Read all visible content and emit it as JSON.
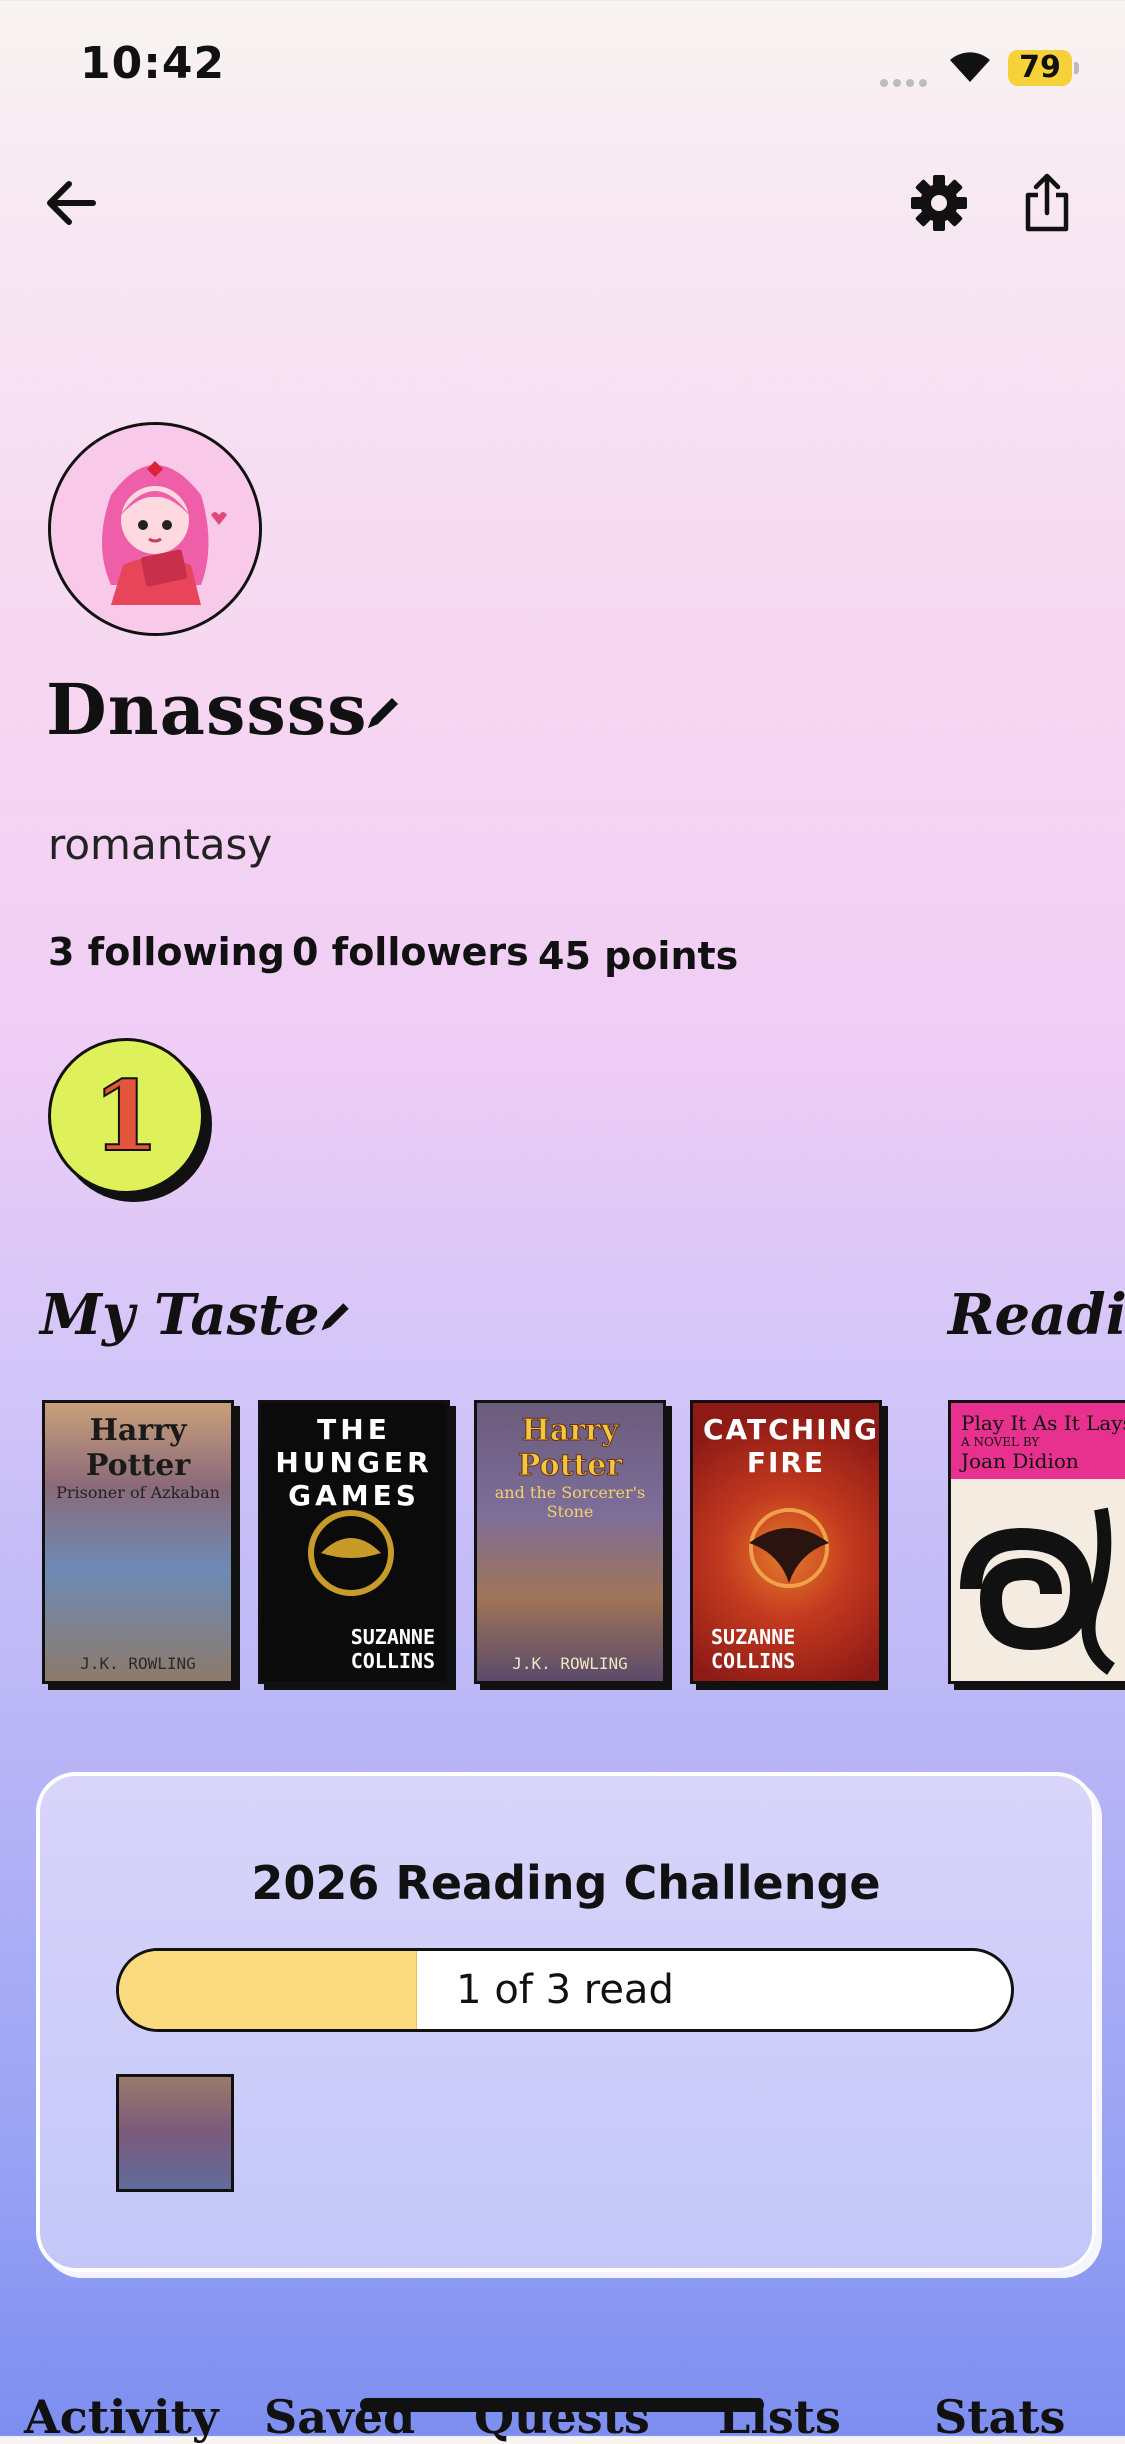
{
  "status_bar": {
    "time": "10:42",
    "battery": "79"
  },
  "nav": {
    "back_icon": "arrow-left-icon",
    "settings_icon": "gear-icon",
    "share_icon": "share-icon"
  },
  "profile": {
    "username": "Dnassss",
    "bio": "romantasy",
    "following": "3 following",
    "followers": "0 followers",
    "points": "45 points",
    "level_badge": "1"
  },
  "sections": {
    "my_taste": "My Taste",
    "reading": "Readin"
  },
  "taste_books": [
    {
      "title": "Harry Potter",
      "subtitle": "Prisoner of Azkaban",
      "author": "J.K. ROWLING"
    },
    {
      "title": "THE HUNGER GAMES",
      "subtitle": "",
      "author": "SUZANNE COLLINS"
    },
    {
      "title": "Harry Potter",
      "subtitle": "and the Sorcerer's Stone",
      "author": "J.K. ROWLING"
    },
    {
      "title": "CATCHING FIRE",
      "subtitle": "",
      "author": "SUZANNE COLLINS"
    }
  ],
  "reading_books": [
    {
      "title": "Play It As It Lays",
      "subtitle": "A NOVEL BY",
      "author": "Joan Didion"
    }
  ],
  "challenge": {
    "title": "2026 Reading Challenge",
    "progress_text": "1 of 3 read",
    "progress_fraction": 0.333
  },
  "tabs": [
    "Activity",
    "Saved",
    "Quests",
    "Lists",
    "Stats"
  ],
  "colors": {
    "badge": "#def15a",
    "progress_fill": "#fcdb7e"
  }
}
